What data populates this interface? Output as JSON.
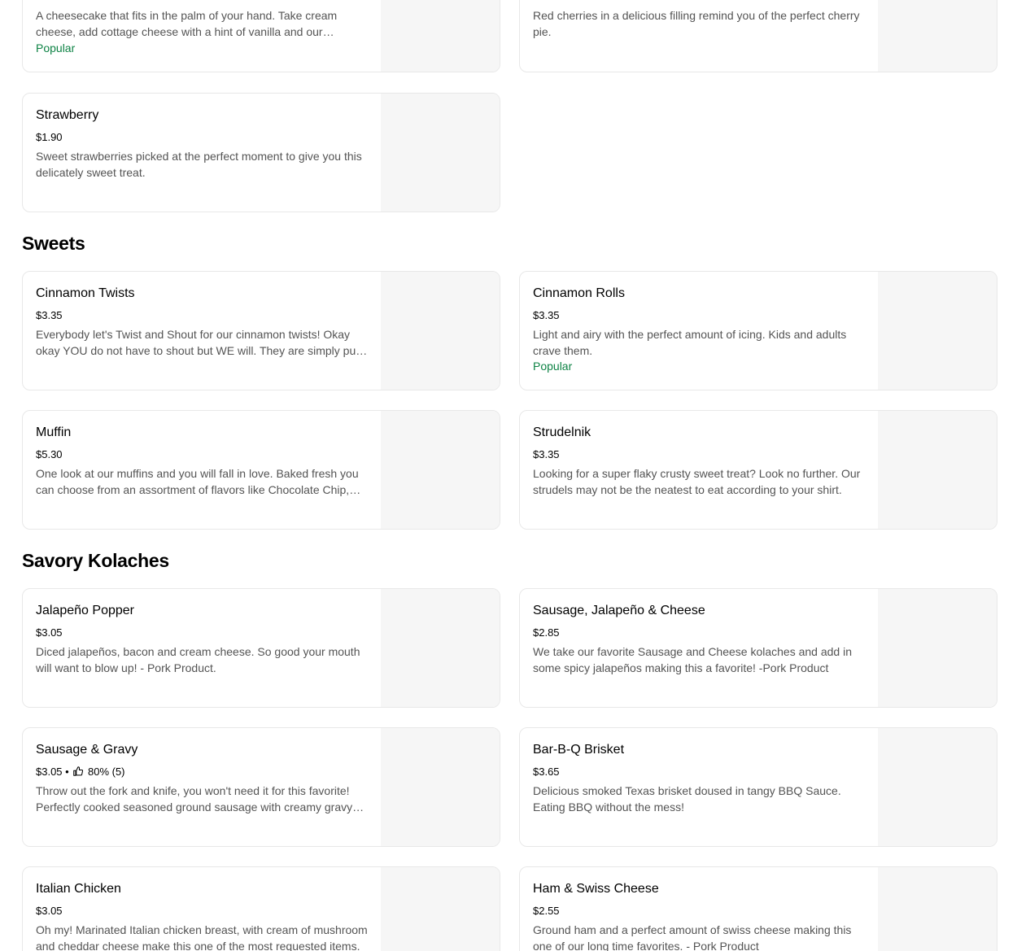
{
  "top_cards": {
    "cheesecake": {
      "desc": "A cheesecake that fits in the palm of your hand. Take cream cheese, add cottage cheese with a hint of vanilla and our signature dough.",
      "tag": "Popular"
    },
    "cherry": {
      "desc": "Red cherries in a delicious filling remind you of the perfect cherry pie."
    },
    "strawberry": {
      "name": "Strawberry",
      "price": "$1.90",
      "desc": "Sweet strawberries picked at the perfect moment to give you this delicately sweet treat."
    }
  },
  "sections": {
    "sweets": {
      "title": "Sweets",
      "items": [
        {
          "name": "Cinnamon Twists",
          "price": "$3.35",
          "desc": "Everybody let's Twist and Shout for our cinnamon twists! Okay okay YOU do not have to shout but WE will. They are simply pure delight."
        },
        {
          "name": "Cinnamon Rolls",
          "price": "$3.35",
          "desc": "Light and airy with the perfect amount of icing. Kids and adults crave them.",
          "tag": "Popular"
        },
        {
          "name": "Muffin",
          "price": "$5.30",
          "desc": "One look at our muffins and you will fall in love. Baked fresh you can choose from an assortment of flavors like Chocolate Chip, Blueberry and more."
        },
        {
          "name": "Strudelnik",
          "price": "$3.35",
          "desc": "Looking for a super flaky crusty sweet treat? Look no further. Our strudels may not be the neatest to eat according to your shirt."
        }
      ]
    },
    "savory": {
      "title": "Savory Kolaches",
      "items": [
        {
          "name": "Jalapeño Popper",
          "price": "$3.05",
          "desc": "Diced jalapeños, bacon and cream cheese. So good your mouth will want to blow up! - Pork Product."
        },
        {
          "name": "Sausage, Jalapeño & Cheese",
          "price": "$2.85",
          "desc": "We take our favorite Sausage and Cheese kolaches and add in some spicy jalapeños making this a favorite! -Pork Product"
        },
        {
          "name": "Sausage & Gravy",
          "price": "$3.05",
          "rating": "80% (5)",
          "desc": "Throw out the fork and knife, you won't need it for this favorite! Perfectly cooked seasoned ground sausage with creamy gravy inside."
        },
        {
          "name": "Bar-B-Q Brisket",
          "price": "$3.65",
          "desc": "Delicious smoked Texas brisket doused in tangy BBQ Sauce. Eating BBQ without the mess!"
        },
        {
          "name": "Italian Chicken",
          "price": "$3.05",
          "desc": "Oh my! Marinated Italian chicken breast, with cream of mushroom and cheddar cheese make this one of the most requested items."
        },
        {
          "name": "Ham & Swiss Cheese",
          "price": "$2.55",
          "desc": "Ground ham and a perfect amount of swiss cheese making this one of our long time favorites. - Pork Product"
        }
      ]
    }
  },
  "colors": {
    "popular_tag": "#0e8345",
    "image_placeholder": "#f6f6f6",
    "card_border": "#e8e8e8",
    "desc_text": "#545454"
  }
}
